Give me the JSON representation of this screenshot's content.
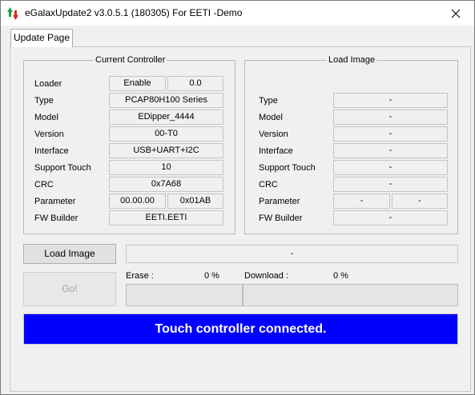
{
  "window": {
    "title": "eGalaxUpdate2 v3.0.5.1 (180305) For EETI -Demo",
    "accent": "#0000ff"
  },
  "tabs": [
    {
      "label": "Update Page",
      "active": true
    }
  ],
  "current_controller": {
    "title": "Current Controller",
    "rows": [
      {
        "label": "Loader",
        "values": [
          "Enable",
          "0.0"
        ]
      },
      {
        "label": "Type",
        "values": [
          "PCAP80H100 Series"
        ]
      },
      {
        "label": "Model",
        "values": [
          "EDipper_4444"
        ]
      },
      {
        "label": "Version",
        "values": [
          "00-T0"
        ]
      },
      {
        "label": "Interface",
        "values": [
          "USB+UART+I2C"
        ]
      },
      {
        "label": "Support Touch",
        "values": [
          "10"
        ]
      },
      {
        "label": "CRC",
        "values": [
          "0x7A68"
        ]
      },
      {
        "label": "Parameter",
        "values": [
          "00.00.00",
          "0x01AB"
        ]
      },
      {
        "label": "FW Builder",
        "values": [
          "EETI.EETI"
        ]
      }
    ]
  },
  "load_image": {
    "title": "Load Image",
    "rows": [
      {
        "label": "Type",
        "values": [
          "-"
        ]
      },
      {
        "label": "Model",
        "values": [
          "-"
        ]
      },
      {
        "label": "Version",
        "values": [
          "-"
        ]
      },
      {
        "label": "Interface",
        "values": [
          "-"
        ]
      },
      {
        "label": "Support Touch",
        "values": [
          "-"
        ]
      },
      {
        "label": "CRC",
        "values": [
          "-"
        ]
      },
      {
        "label": "Parameter",
        "values": [
          "-",
          "-"
        ]
      },
      {
        "label": "FW Builder",
        "values": [
          "-"
        ]
      }
    ]
  },
  "actions": {
    "load_image_label": "Load Image",
    "image_path": "-",
    "go_label": "Go!",
    "erase_label": "Erase :",
    "erase_percent": "0 %",
    "erase_progress": 0,
    "download_label": "Download :",
    "download_percent": "0 %",
    "download_progress": 0
  },
  "status": {
    "message": "Touch controller connected.",
    "color": "#0000ff"
  }
}
